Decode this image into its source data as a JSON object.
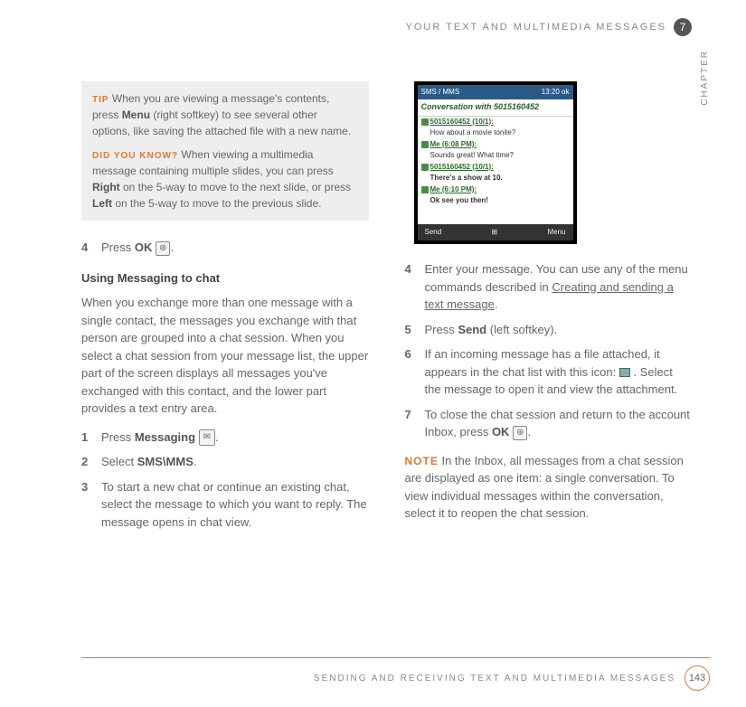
{
  "header": {
    "title": "YOUR TEXT AND MULTIMEDIA MESSAGES",
    "chapter_number": "7",
    "chapter_label": "CHAPTER"
  },
  "callout": {
    "tip_label": "TIP",
    "tip_text_1": "When you are viewing a message's contents, press ",
    "tip_bold_1": "Menu",
    "tip_text_2": " (right softkey) to see several other options, like saving the attached file with a new name.",
    "dyk_label": "DID YOU KNOW?",
    "dyk_text_1": "When viewing a multimedia message containing multiple slides, you can press ",
    "dyk_bold_1": "Right",
    "dyk_text_2": " on the 5-way to move to the next slide, or press ",
    "dyk_bold_2": "Left",
    "dyk_text_3": " on the 5-way to move to the previous slide."
  },
  "left": {
    "step4_num": "4",
    "step4_a": "Press ",
    "step4_bold": "OK",
    "step4_b": " ",
    "step4_icon": "⊛",
    "step4_c": ".",
    "subhead": "Using Messaging to chat",
    "intro": "When you exchange more than one message with a single contact, the messages you exchange with that person are grouped into a chat session. When you select a chat session from your message list, the upper part of the screen displays all messages you've exchanged with this contact, and the lower part provides a text entry area.",
    "s1_num": "1",
    "s1_a": "Press ",
    "s1_bold": "Messaging",
    "s1_b": " ",
    "s1_icon": "✉",
    "s1_c": ".",
    "s2_num": "2",
    "s2_a": "Select ",
    "s2_bold": "SMS\\MMS",
    "s2_b": ".",
    "s3_num": "3",
    "s3_text": "To start a new chat or continue an existing chat, select the message to which you want to reply. The message opens in chat view."
  },
  "screenshot": {
    "titlebar_left": "SMS / MMS",
    "titlebar_right": "13:20 ok",
    "conv_title": "Conversation with 5015160452",
    "messages": [
      {
        "sender": "5015160452 (10/1):",
        "text": "How about a movie tonite?"
      },
      {
        "sender": "Me (6:08 PM):",
        "text": "Sounds great! What time?"
      },
      {
        "sender": "5015160452 (10/1):",
        "text": "There's a show at 10."
      },
      {
        "sender": "Me (6:10 PM):",
        "text": "Ok see you then!"
      }
    ],
    "bottom_left": "Send",
    "bottom_right": "Menu"
  },
  "right": {
    "s4_num": "4",
    "s4_a": "Enter your message. You can use any of the menu commands described in ",
    "s4_link": "Creating and sending a text message",
    "s4_b": ".",
    "s5_num": "5",
    "s5_a": "Press ",
    "s5_bold": "Send",
    "s5_b": " (left softkey).",
    "s6_num": "6",
    "s6_a": "If an incoming message has a file attached, it appears in the chat list with this icon: ",
    "s6_b": " . Select the message to open it and view the attachment.",
    "s7_num": "7",
    "s7_a": "To close the chat session and return to the account Inbox, press ",
    "s7_bold": "OK",
    "s7_b": " ",
    "s7_icon": "⊛",
    "s7_c": ".",
    "note_label": "NOTE",
    "note_text": " In the Inbox, all messages from a chat session are displayed as one item: a single conversation. To view individual messages within the conversation, select it to reopen the chat session."
  },
  "footer": {
    "text": "SENDING AND RECEIVING TEXT AND MULTIMEDIA MESSAGES",
    "page": "143"
  }
}
